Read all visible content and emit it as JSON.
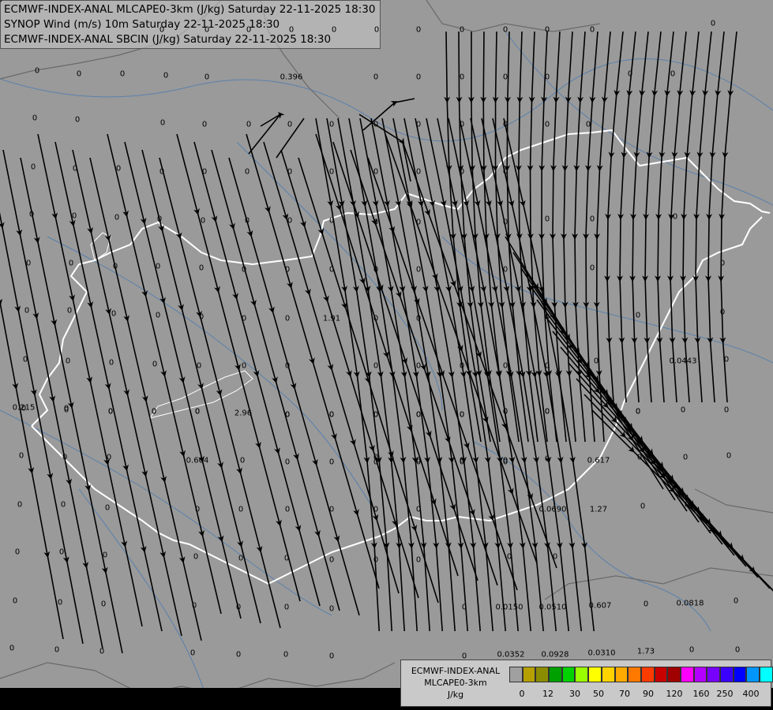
{
  "header": {
    "line1": "ECMWF-INDEX-ANAL MLCAPE0-3km (J/kg) Saturday 22-11-2025 18:30",
    "line2": "SYNOP Wind (m/s) 10m Saturday 22-11-2025 18:30",
    "line3": "ECMWF-INDEX-ANAL SBCIN (J/kg) Saturday 22-11-2025 18:30"
  },
  "legend": {
    "title1": "ECMWF-INDEX-ANAL",
    "title2": "MLCAPE0-3km",
    "unit": "J/kg",
    "colors": [
      "#a0a0a0",
      "#b5a000",
      "#8c8c00",
      "#00a000",
      "#00d200",
      "#9aff00",
      "#ffff00",
      "#ffd200",
      "#ffaa00",
      "#ff7800",
      "#ff3c00",
      "#c80000",
      "#a00000",
      "#ff00ff",
      "#b400ff",
      "#7800ff",
      "#3c00ff",
      "#0000ff",
      "#0096ff",
      "#00ffff",
      "#b4ffff",
      "#ffffff"
    ],
    "ticks": [
      "0",
      "12",
      "30",
      "50",
      "70",
      "90",
      "120",
      "160",
      "250",
      "400"
    ]
  },
  "values": [
    "0",
    "0",
    "0",
    "0",
    "0",
    "0",
    "0",
    "0",
    "0",
    "0",
    "0",
    "0",
    "0",
    "0",
    "0",
    "0",
    "0",
    "0.396",
    "0",
    "0",
    "0",
    "0",
    "0",
    "0",
    "0",
    "0",
    "0",
    "0",
    "0",
    "0",
    "0",
    "0",
    "0",
    "0",
    "0",
    "0",
    "0",
    "0",
    "0",
    "0",
    "0",
    "0",
    "0",
    "0",
    "0",
    "0",
    "0",
    "0",
    "0",
    "0",
    "0",
    "0",
    "0",
    "0",
    "0",
    "0",
    "0",
    "0",
    "0",
    "0",
    "0",
    "0",
    "0",
    "0",
    "0",
    "0",
    "0",
    "0",
    "0",
    "0",
    "0",
    "0",
    "0",
    "0",
    "0",
    "0",
    "0",
    "0",
    "0",
    "0",
    "0",
    "0",
    "0",
    "0",
    "0",
    "0",
    "0",
    "0",
    "0",
    "0",
    "0",
    "0",
    "0",
    "0",
    "0",
    "0",
    "0",
    "0",
    "0",
    "0",
    "0",
    "0",
    "0",
    "0",
    "0",
    "1.91",
    "0",
    "0",
    "0",
    "0",
    "0",
    "0",
    "0",
    "0",
    "0",
    "0",
    "0",
    "0",
    "0",
    "0",
    "0",
    "0",
    "0",
    "0.0443",
    "0",
    "0.215",
    "0",
    "0",
    "0",
    "0",
    "2.96",
    "0",
    "0",
    "0",
    "0",
    "0",
    "0",
    "0",
    "0",
    "0",
    "0",
    "0",
    "0.604",
    "0",
    "0",
    "0",
    "0",
    "0",
    "0",
    "0",
    "0.617",
    "0",
    "0",
    "0",
    "0",
    "0",
    "0",
    "0",
    "0",
    "0",
    "0",
    "0",
    "0",
    "0.0690",
    "1.27",
    "0",
    "0",
    "0",
    "0",
    "0",
    "0",
    "0",
    "0",
    "0",
    "0",
    "0",
    "0",
    "0",
    "0",
    "0",
    "0",
    "0",
    "0",
    "0",
    "0",
    "0",
    "0.0150",
    "0.607",
    "0",
    "0.0818",
    "0",
    "0.0510",
    "0",
    "0",
    "0",
    "0",
    "0",
    "0",
    "0",
    "0",
    "0.0352",
    "0.0928",
    "0.0310",
    "1.73",
    "0",
    "0",
    "0"
  ]
}
